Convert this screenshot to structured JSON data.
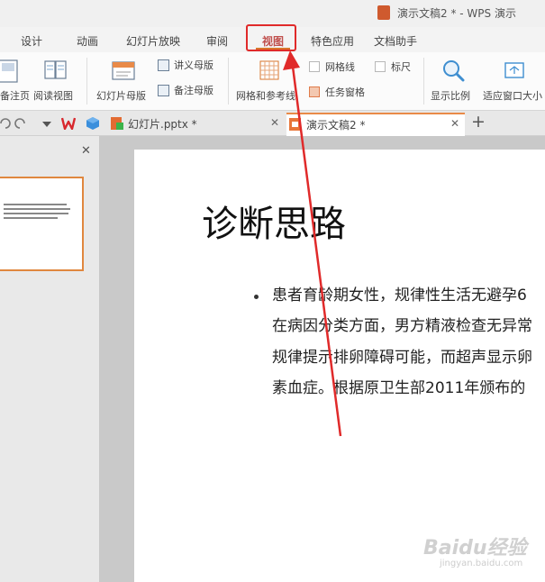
{
  "window": {
    "title": "演示文稿2 * - WPS 演示"
  },
  "menu": {
    "tabs": [
      {
        "label": "设计"
      },
      {
        "label": "动画"
      },
      {
        "label": "幻灯片放映"
      },
      {
        "label": "审阅"
      },
      {
        "label": "视图",
        "active": true
      },
      {
        "label": "特色应用"
      },
      {
        "label": "文档助手"
      }
    ]
  },
  "ribbon": {
    "notes_page": "备注页",
    "reading_view": "阅读视图",
    "slide_master": "幻灯片母版",
    "handout_master": "讲义母版",
    "notes_master": "备注母版",
    "grid_guides": "网格和参考线",
    "gridlines": "网格线",
    "task_pane": "任务窗格",
    "ruler": "标尺",
    "zoom": "显示比例",
    "fit_window": "适应窗口大小"
  },
  "doc_tabs": [
    {
      "label": "幻灯片.pptx *"
    },
    {
      "label": "演示文稿2 *",
      "active": true
    }
  ],
  "slide": {
    "title": "诊断思路",
    "body_lines": [
      "患者育龄期女性，规律性生活无避孕6",
      "在病因分类方面，男方精液检查无异常",
      "规律提示排卵障碍可能，而超声显示卵",
      "素血症。根据原卫生部2011年颁布的"
    ]
  },
  "watermark": {
    "main": "Baidu经验",
    "sub": "jingyan.baidu.com"
  },
  "colors": {
    "accent": "#d9762b",
    "highlight": "#e02a2a",
    "menu_active": "#c0504d"
  },
  "icons": [
    "doc-icon",
    "undo-icon",
    "redo-icon",
    "wps-logo-icon",
    "cube-icon",
    "pptx-file-icon",
    "add-tab-icon",
    "close-icon"
  ]
}
